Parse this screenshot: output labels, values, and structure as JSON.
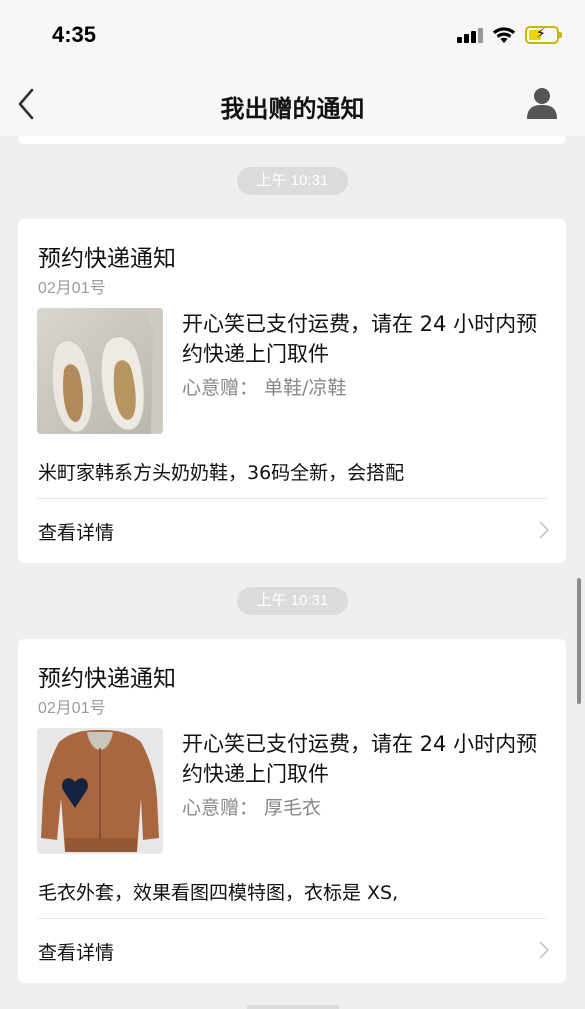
{
  "status_bar": {
    "time": "4:35"
  },
  "nav": {
    "title": "我出赠的通知"
  },
  "notifications": [
    {
      "timestamp": "上午 10:31",
      "title": "预约快递通知",
      "date": "02月01号",
      "message": "开心笑已支付运费，请在 24 小时内预约快递上门取件",
      "gift_label": "心意赠：",
      "gift_item": "单鞋/凉鞋",
      "description": "米町家韩系方头奶奶鞋，36码全新，会搭配",
      "link_label": "查看详情",
      "thumbnail": "shoes-photo"
    },
    {
      "timestamp": "上午 10:31",
      "title": "预约快递通知",
      "date": "02月01号",
      "message": "开心笑已支付运费，请在 24 小时内预约快递上门取件",
      "gift_label": "心意赠：",
      "gift_item": "厚毛衣",
      "description": "毛衣外套，效果看图四模特图，衣标是 XS,",
      "link_label": "查看详情",
      "thumbnail": "sweater-photo"
    }
  ]
}
